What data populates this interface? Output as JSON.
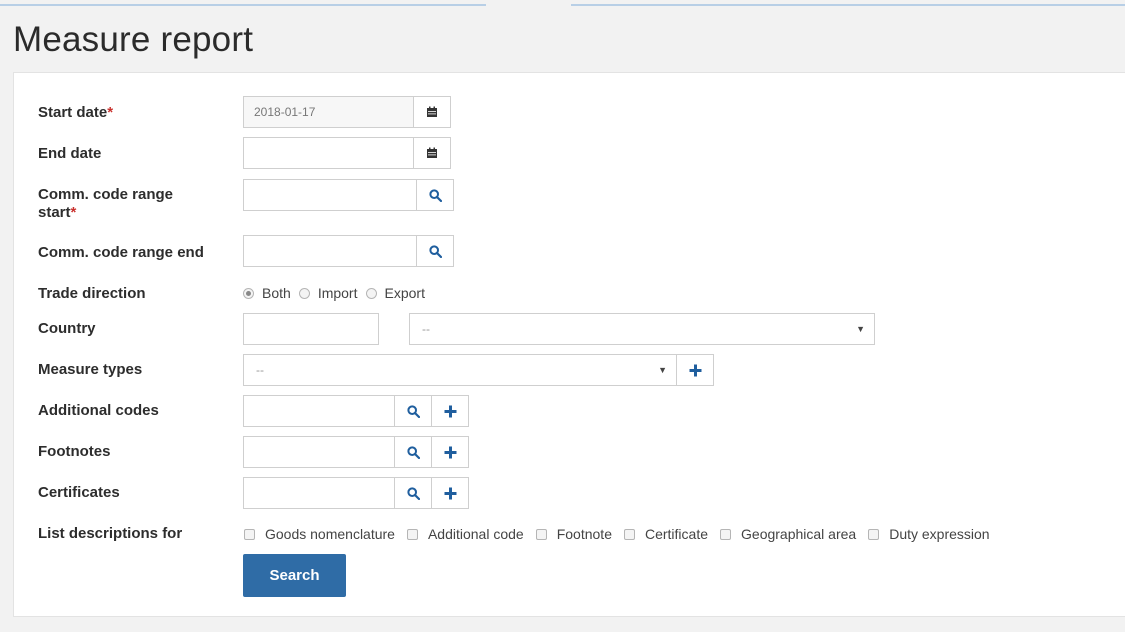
{
  "page": {
    "title": "Measure report"
  },
  "form": {
    "start_date": {
      "label": "Start date",
      "required_mark": "*",
      "value": "2018-01-17",
      "icon": "calendar-icon"
    },
    "end_date": {
      "label": "End date",
      "value": "",
      "icon": "calendar-icon"
    },
    "comm_code_start": {
      "label": "Comm. code range",
      "label_line2": "start",
      "required_mark": "*",
      "value": "",
      "icon": "search-icon"
    },
    "comm_code_end": {
      "label": "Comm. code range end",
      "value": "",
      "icon": "search-icon"
    },
    "trade_direction": {
      "label": "Trade direction",
      "options": [
        "Both",
        "Import",
        "Export"
      ],
      "selected": "Both"
    },
    "country": {
      "label": "Country",
      "code_value": "",
      "select_value": "--"
    },
    "measure_types": {
      "label": "Measure types",
      "select_value": "--",
      "add_icon": "plus-icon"
    },
    "additional_codes": {
      "label": "Additional codes",
      "value": ""
    },
    "footnotes": {
      "label": "Footnotes",
      "value": ""
    },
    "certificates": {
      "label": "Certificates",
      "value": ""
    },
    "list_descriptions": {
      "label": "List descriptions for",
      "options": [
        "Goods nomenclature",
        "Additional code",
        "Footnote",
        "Certificate",
        "Geographical area",
        "Duty expression"
      ]
    },
    "search_button": "Search"
  },
  "colors": {
    "accent": "#2f6ca6",
    "required": "#c9302c",
    "icon": "#1f5e9e"
  }
}
